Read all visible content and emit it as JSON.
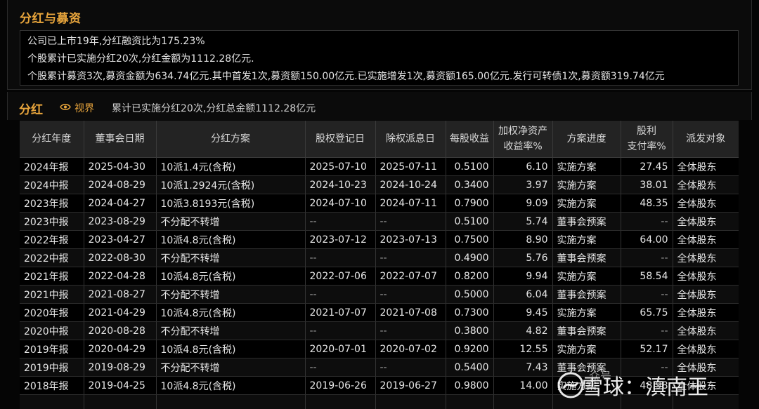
{
  "financing": {
    "title": "分红与募资",
    "lines": [
      "公司已上市19年,分红融资比为175.23%",
      "个股累计已实施分红20次,分红金额为1112.28亿元.",
      "个股累计募资3次,募资金额为634.74亿元.其中首发1次,募资额150.00亿元.已实施增发1次,募资额165.00亿元.发行可转债1次,募资额319.74亿元"
    ]
  },
  "dividend": {
    "title": "分红",
    "view_label": "视界",
    "summary": "累计已实施分红20次,分红总金额1112.28亿元",
    "columns": [
      "分红年度",
      "董事会日期",
      "分红方案",
      "股权登记日",
      "除权派息日",
      "每股收益",
      "加权净资产\n收益率%",
      "方案进度",
      "股利\n支付率%",
      "派发对象"
    ],
    "rows": [
      [
        "2024年报",
        "2025-04-30",
        "10派1.4元(含税)",
        "2025-07-10",
        "2025-07-11",
        "0.5100",
        "6.10",
        "实施方案",
        "27.45",
        "全体股东"
      ],
      [
        "2024中报",
        "2024-08-29",
        "10派1.2924元(含税)",
        "2024-10-23",
        "2024-10-24",
        "0.3400",
        "3.97",
        "实施方案",
        "38.01",
        "全体股东"
      ],
      [
        "2023年报",
        "2024-04-27",
        "10派3.8193元(含税)",
        "2024-07-10",
        "2024-07-11",
        "0.7900",
        "9.09",
        "实施方案",
        "48.35",
        "全体股东"
      ],
      [
        "2023中报",
        "2023-08-29",
        "不分配不转增",
        "--",
        "--",
        "0.5100",
        "5.74",
        "董事会预案",
        "--",
        "全体股东"
      ],
      [
        "2022年报",
        "2023-04-27",
        "10派4.8元(含税)",
        "2023-07-12",
        "2023-07-13",
        "0.7500",
        "8.90",
        "实施方案",
        "64.00",
        "全体股东"
      ],
      [
        "2022中报",
        "2022-08-30",
        "不分配不转增",
        "--",
        "--",
        "0.4900",
        "5.76",
        "董事会预案",
        "--",
        "全体股东"
      ],
      [
        "2021年报",
        "2022-04-28",
        "10派4.8元(含税)",
        "2022-07-06",
        "2022-07-07",
        "0.8200",
        "9.94",
        "实施方案",
        "58.54",
        "全体股东"
      ],
      [
        "2021中报",
        "2021-08-27",
        "不分配不转增",
        "--",
        "--",
        "0.5000",
        "6.04",
        "董事会预案",
        "--",
        "全体股东"
      ],
      [
        "2020年报",
        "2021-04-29",
        "10派4.8元(含税)",
        "2021-07-07",
        "2021-07-08",
        "0.7300",
        "9.45",
        "实施方案",
        "65.75",
        "全体股东"
      ],
      [
        "2020中报",
        "2020-08-28",
        "不分配不转增",
        "--",
        "--",
        "0.3800",
        "4.82",
        "董事会预案",
        "--",
        "全体股东"
      ],
      [
        "2019年报",
        "2020-04-29",
        "10派4.8元(含税)",
        "2020-07-01",
        "2020-07-02",
        "0.9200",
        "12.55",
        "实施方案",
        "52.17",
        "全体股东"
      ],
      [
        "2019中报",
        "2019-08-29",
        "不分配不转增",
        "--",
        "--",
        "0.5400",
        "7.43",
        "董事会预案",
        "--",
        "全体股东"
      ],
      [
        "2018年报",
        "2019-04-25",
        "10派4.8元(含税)",
        "2019-06-26",
        "2019-06-27",
        "0.9800",
        "14.00",
        "实施方案",
        "48.98",
        "全体股东"
      ],
      [
        "",
        "",
        "",
        "",
        "",
        "",
        "",
        "",
        "",
        ""
      ]
    ]
  },
  "watermark": {
    "text": "雪球：滇南王",
    "sub": "众号 ·"
  },
  "colors": {
    "accent": "#e8a53c",
    "background": "#000000",
    "header_bg": "#232323"
  }
}
